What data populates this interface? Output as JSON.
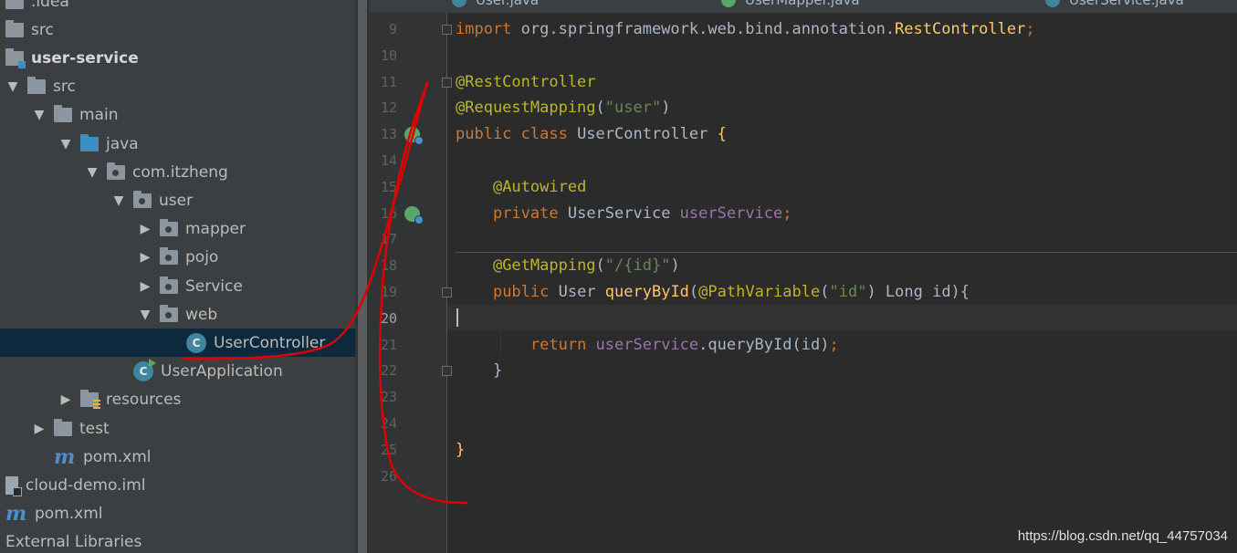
{
  "project_tree": [
    {
      "label": ".idea",
      "icon": "folder-icon",
      "depth": 0,
      "arrow": "none"
    },
    {
      "label": "src",
      "icon": "folder-icon",
      "depth": 0,
      "arrow": "none"
    },
    {
      "label": "user-service",
      "icon": "module-folder-icon",
      "depth": 0,
      "arrow": "none",
      "bold": true
    },
    {
      "label": "src",
      "icon": "folder-icon",
      "depth": 0,
      "arrow": "expanded"
    },
    {
      "label": "main",
      "icon": "folder-icon",
      "depth": 1,
      "arrow": "expanded"
    },
    {
      "label": "java",
      "icon": "source-folder-icon",
      "depth": 2,
      "arrow": "expanded"
    },
    {
      "label": "com.itzheng",
      "icon": "package-icon",
      "depth": 3,
      "arrow": "expanded"
    },
    {
      "label": "user",
      "icon": "package-icon",
      "depth": 4,
      "arrow": "expanded"
    },
    {
      "label": "mapper",
      "icon": "package-icon",
      "depth": 5,
      "arrow": "collapsed"
    },
    {
      "label": "pojo",
      "icon": "package-icon",
      "depth": 5,
      "arrow": "collapsed"
    },
    {
      "label": "Service",
      "icon": "package-icon",
      "depth": 5,
      "arrow": "collapsed"
    },
    {
      "label": "web",
      "icon": "package-icon",
      "depth": 5,
      "arrow": "expanded"
    },
    {
      "label": "UserController",
      "icon": "java-class-icon",
      "depth": 6,
      "arrow": "none",
      "selected": true
    },
    {
      "label": "UserApplication",
      "icon": "spring-boot-app-icon",
      "depth": 4,
      "arrow": "none"
    },
    {
      "label": "resources",
      "icon": "resources-folder-icon",
      "depth": 2,
      "arrow": "collapsed"
    },
    {
      "label": "test",
      "icon": "folder-icon",
      "depth": 1,
      "arrow": "collapsed"
    },
    {
      "label": "pom.xml",
      "icon": "maven-icon",
      "depth": 1,
      "arrow": "none"
    },
    {
      "label": "cloud-demo.iml",
      "icon": "iml-file-icon",
      "depth": 0,
      "arrow": "none"
    },
    {
      "label": "pom.xml",
      "icon": "maven-icon",
      "depth": 0,
      "arrow": "none"
    },
    {
      "label": "External Libraries",
      "icon": "library-icon",
      "depth": 0,
      "arrow": "none"
    }
  ],
  "tabs": [
    {
      "label": "User.java",
      "icon_color": "#3e86a0"
    },
    {
      "label": "UserMapper.java",
      "icon_color": "#59a869"
    },
    {
      "label": "UserService.java",
      "icon_color": "#3e86a0"
    }
  ],
  "editor": {
    "active_line": "20",
    "lines": [
      {
        "num": "9",
        "tokens": [
          [
            "kw",
            "import "
          ],
          [
            "",
            "org.springframework.web.bind.annotation."
          ],
          [
            "fn",
            "RestController"
          ],
          [
            "kw",
            ";"
          ]
        ]
      },
      {
        "num": "10",
        "tokens": []
      },
      {
        "num": "11",
        "tokens": [
          [
            "ann",
            "@RestController"
          ]
        ]
      },
      {
        "num": "12",
        "tokens": [
          [
            "ann",
            "@RequestMapping"
          ],
          [
            "",
            "("
          ],
          [
            "str",
            "\"user\""
          ],
          [
            "",
            ")"
          ]
        ]
      },
      {
        "num": "13",
        "tokens": [
          [
            "kw",
            "public class "
          ],
          [
            "",
            "UserController "
          ],
          [
            "fn",
            "{"
          ]
        ]
      },
      {
        "num": "14",
        "tokens": []
      },
      {
        "num": "15",
        "tokens": [
          [
            "",
            "    "
          ],
          [
            "ann",
            "@Autowired"
          ]
        ]
      },
      {
        "num": "16",
        "tokens": [
          [
            "",
            "    "
          ],
          [
            "kw",
            "private "
          ],
          [
            "",
            "UserService "
          ],
          [
            "fld",
            "userService"
          ],
          [
            "kw",
            ";"
          ]
        ]
      },
      {
        "num": "17",
        "tokens": []
      },
      {
        "num": "18",
        "tokens": [
          [
            "",
            "    "
          ],
          [
            "ann",
            "@GetMapping"
          ],
          [
            "",
            "("
          ],
          [
            "str",
            "\"/{id}\""
          ],
          [
            "",
            ")"
          ]
        ]
      },
      {
        "num": "19",
        "tokens": [
          [
            "",
            "    "
          ],
          [
            "kw",
            "public "
          ],
          [
            "",
            "User "
          ],
          [
            "fn",
            "queryById"
          ],
          [
            "",
            "("
          ],
          [
            "ann",
            "@PathVariable"
          ],
          [
            "",
            "("
          ],
          [
            "str",
            "\"id\""
          ],
          [
            "",
            ") Long id){"
          ]
        ]
      },
      {
        "num": "20",
        "tokens": []
      },
      {
        "num": "21",
        "tokens": [
          [
            "",
            "        "
          ],
          [
            "kw",
            "return "
          ],
          [
            "fld",
            "userService"
          ],
          [
            "",
            ".queryById(id)"
          ],
          [
            "kw",
            ";"
          ]
        ]
      },
      {
        "num": "22",
        "tokens": [
          [
            "",
            "    "
          ],
          [
            "",
            "}"
          ]
        ]
      },
      {
        "num": "23",
        "tokens": []
      },
      {
        "num": "24",
        "tokens": []
      },
      {
        "num": "25",
        "tokens": [
          [
            "fn",
            "}"
          ]
        ]
      },
      {
        "num": "26",
        "tokens": []
      }
    ]
  },
  "watermark": "https://blog.csdn.net/qq_44757034",
  "colors": {
    "sidebar_bg": "#3c3f41",
    "editor_bg": "#2b2b2b",
    "selection": "#0d293e",
    "annotation_ink": "#e00000"
  }
}
